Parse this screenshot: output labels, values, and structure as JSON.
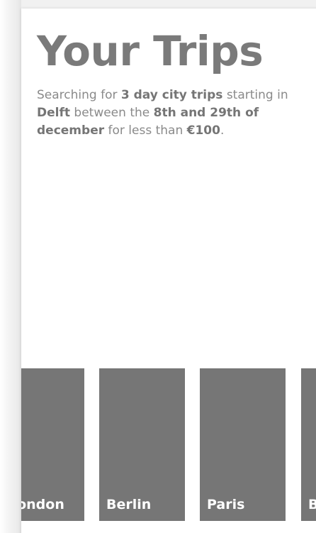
{
  "page": {
    "title": "Your Trips",
    "summary": {
      "p1": "Searching for ",
      "trip_type": "3 day city trips",
      "p2": " starting in ",
      "origin": "Delft",
      "p3": " between the ",
      "date_range": "8th and 29th of december",
      "p4": " for less than ",
      "budget": "€100",
      "p5": "."
    }
  },
  "trips": [
    {
      "city": "London"
    },
    {
      "city": "Berlin"
    },
    {
      "city": "Paris"
    },
    {
      "city": "B"
    }
  ],
  "colors": {
    "card": "#767676",
    "heading": "#7a7a7a",
    "text": "#8a8a8a"
  }
}
